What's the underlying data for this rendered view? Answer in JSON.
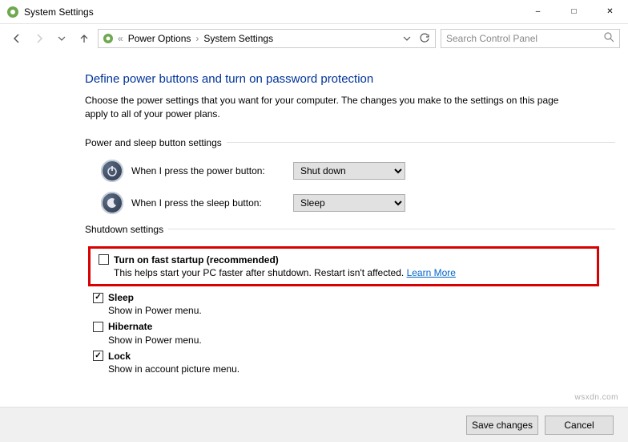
{
  "window": {
    "title": "System Settings"
  },
  "breadcrumbs": {
    "item1": "Power Options",
    "item2": "System Settings"
  },
  "search": {
    "placeholder": "Search Control Panel"
  },
  "page": {
    "title": "Define power buttons and turn on password protection",
    "description": "Choose the power settings that you want for your computer. The changes you make to the settings on this page apply to all of your power plans."
  },
  "section1": {
    "header": "Power and sleep button settings",
    "power_label": "When I press the power button:",
    "power_value": "Shut down",
    "sleep_label": "When I press the sleep button:",
    "sleep_value": "Sleep"
  },
  "section2": {
    "header": "Shutdown settings",
    "items": [
      {
        "label": "Turn on fast startup (recommended)",
        "desc": "This helps start your PC faster after shutdown. Restart isn't affected.",
        "learn": "Learn More",
        "checked": false
      },
      {
        "label": "Sleep",
        "desc": "Show in Power menu.",
        "checked": true
      },
      {
        "label": "Hibernate",
        "desc": "Show in Power menu.",
        "checked": false
      },
      {
        "label": "Lock",
        "desc": "Show in account picture menu.",
        "checked": true
      }
    ]
  },
  "footer": {
    "save": "Save changes",
    "cancel": "Cancel"
  },
  "watermark": "wsxdn.com"
}
